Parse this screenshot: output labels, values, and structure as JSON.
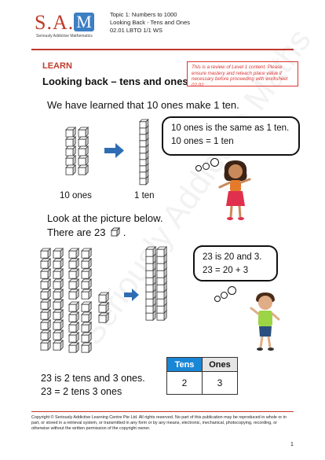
{
  "header": {
    "logo_text": "S.A.",
    "logo_m": "M",
    "logo_tag": "Seriously Addictive Mathematics",
    "topic_line": "Topic 1: Numbers to 1000",
    "subtopic_line": "Looking Back  - Tens and Ones",
    "code_line": "02.01 LBTO 1/1 WS"
  },
  "section_label": "LEARN",
  "title": "Looking back – tens and ones",
  "note": "This is a review of Level 1 content. Please ensure mastery and reteach place value if necessary before proceeding with worksheet 02.02.",
  "intro": "We have learned that 10 ones make 1 ten.",
  "bubble1": {
    "line1": "10 ones is the same as 1 ten.",
    "line2": "10 ones = 1 ten"
  },
  "label_ones": "10 ones",
  "label_ten": "1 ten",
  "look_line1": "Look at the picture below.",
  "look_line2_pre": "There are 23",
  "look_line2_post": ".",
  "bubble2": {
    "line1": "23 is 20 and 3.",
    "line2": "23 = 20 + 3"
  },
  "conclusion1": "23 is 2 tens and 3 ones.",
  "conclusion2": "23 = 2 tens 3 ones",
  "table": {
    "headers": [
      "Tens",
      "Ones"
    ],
    "values": [
      "2",
      "3"
    ]
  },
  "copyright": "Copyright © Seriously Addictive Learning Centre Pte Ltd. All rights reserved. No part of this publication may be reproduced in whole or in part, or stored in a retrieval system, or transmitted in any form or by any means, electronic, mechanical, photocopying, recording, or otherwise without the written permission of the copyright owner.",
  "page_number": "1",
  "watermark": "Seriously Addictive Maths",
  "colors": {
    "brand_red": "#c0392b",
    "brand_blue": "#3d7fc4",
    "table_header_blue": "#1a86d6",
    "arrow_blue": "#2e6db4"
  }
}
